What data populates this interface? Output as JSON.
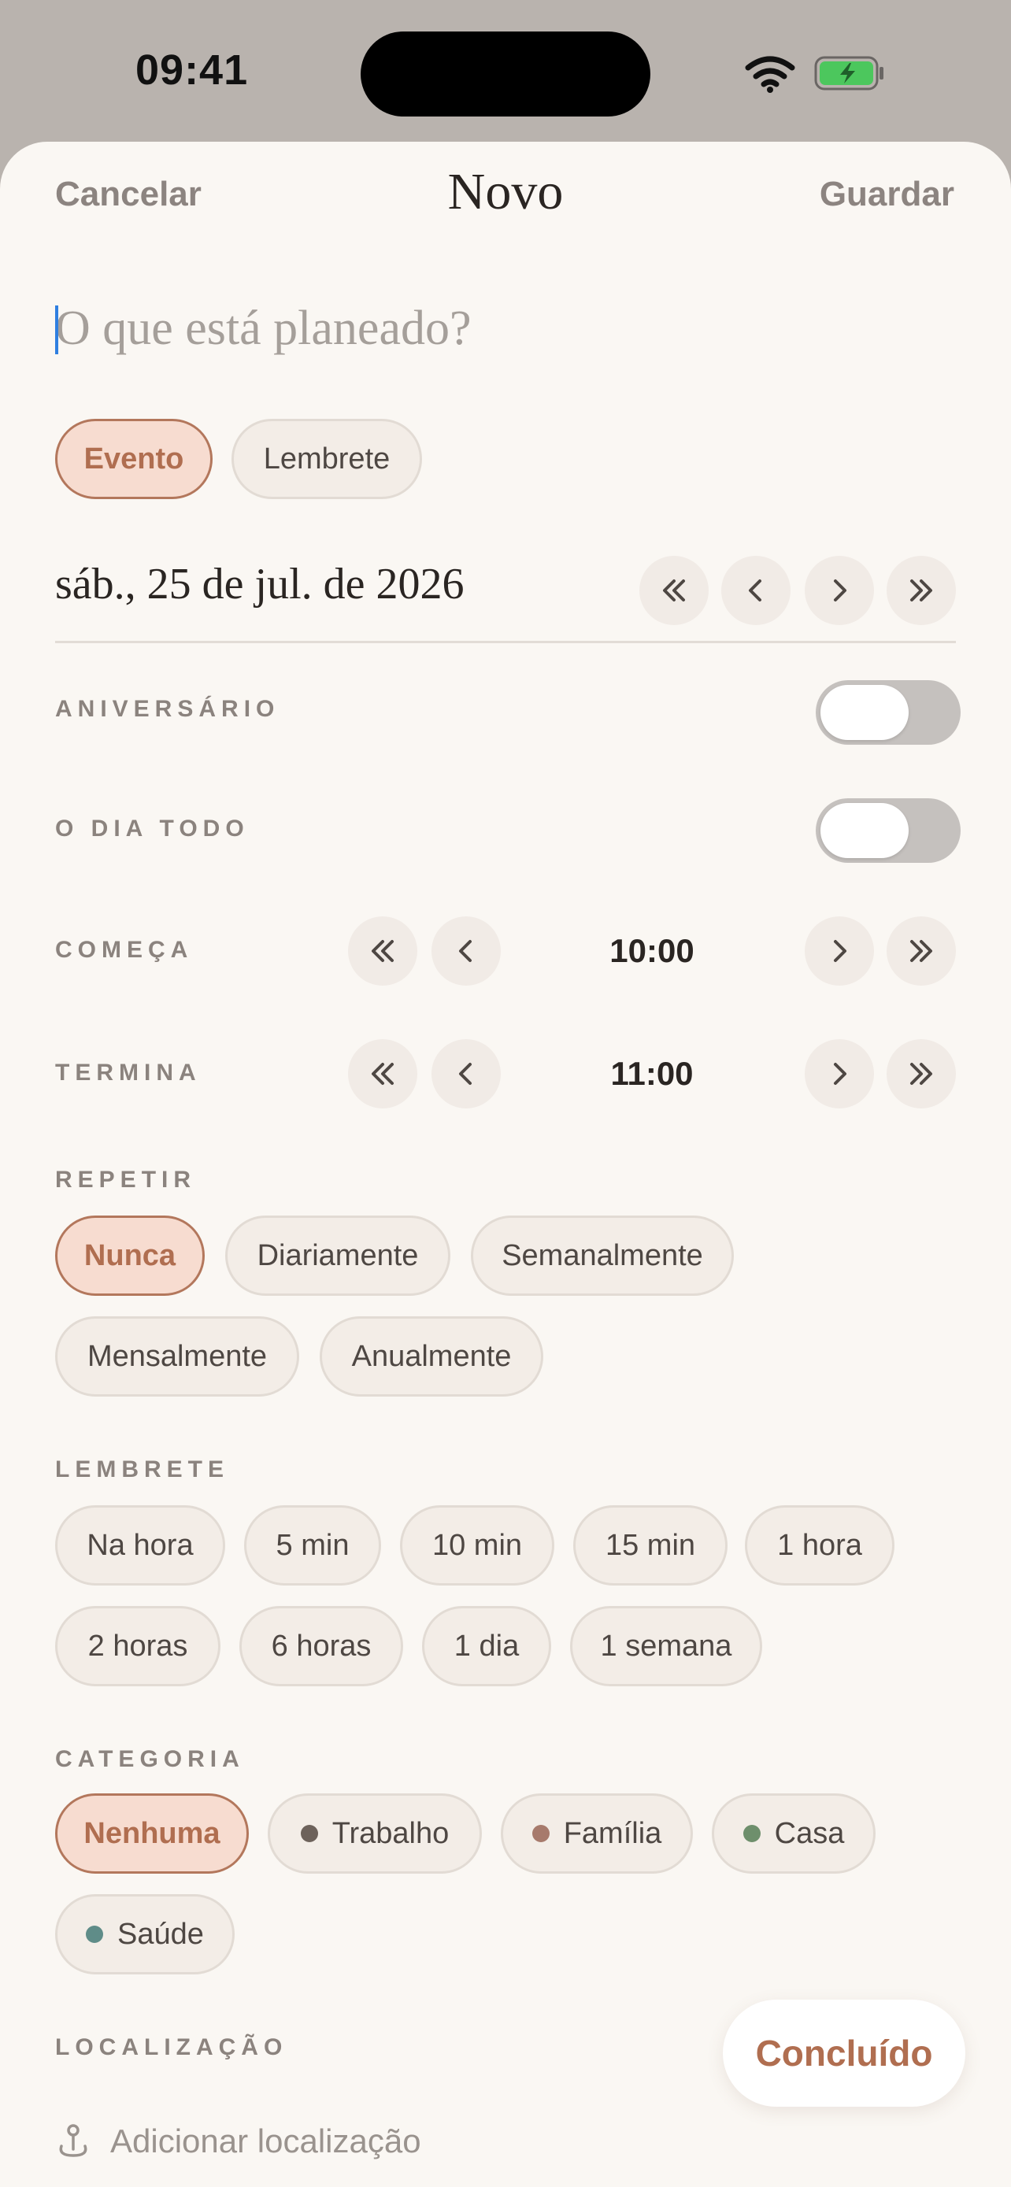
{
  "status_bar": {
    "time": "09:41"
  },
  "nav": {
    "cancel": "Cancelar",
    "title": "Novo",
    "save": "Guardar"
  },
  "title_field": {
    "placeholder": "O que está planeado?",
    "value": ""
  },
  "type_chips": [
    {
      "label": "Evento",
      "selected": true
    },
    {
      "label": "Lembrete",
      "selected": false
    }
  ],
  "date": {
    "text": "sáb., 25 de jul. de 2026"
  },
  "birthday": {
    "label": "ANIVERSÁRIO",
    "on": false
  },
  "all_day": {
    "label": "O DIA TODO",
    "on": false
  },
  "starts": {
    "label": "COMEÇA",
    "time": "10:00"
  },
  "ends": {
    "label": "TERMINA",
    "time": "11:00"
  },
  "repeat": {
    "label": "REPETIR",
    "options": [
      "Nunca",
      "Diariamente",
      "Semanalmente",
      "Mensalmente",
      "Anualmente"
    ],
    "selected": "Nunca"
  },
  "reminder": {
    "label": "LEMBRETE",
    "options": [
      "Na hora",
      "5 min",
      "10 min",
      "15 min",
      "1 hora",
      "2 horas",
      "6 horas",
      "1 dia",
      "1 semana"
    ]
  },
  "category": {
    "label": "CATEGORIA",
    "options": [
      {
        "label": "Nenhuma",
        "selected": true,
        "color": ""
      },
      {
        "label": "Trabalho",
        "selected": false,
        "color": "#6d625b"
      },
      {
        "label": "Família",
        "selected": false,
        "color": "#a77a6c"
      },
      {
        "label": "Casa",
        "selected": false,
        "color": "#6e8f6c"
      },
      {
        "label": "Saúde",
        "selected": false,
        "color": "#5f8c88"
      }
    ]
  },
  "location": {
    "label": "LOCALIZAÇÃO",
    "placeholder": "Adicionar localização"
  },
  "done_button": {
    "label": "Concluído"
  },
  "colors": {
    "accent": "#b06e50",
    "accent_bg": "#f7dcd0",
    "sheet_bg": "#faf7f3",
    "battery_green": "#4cc75d"
  }
}
